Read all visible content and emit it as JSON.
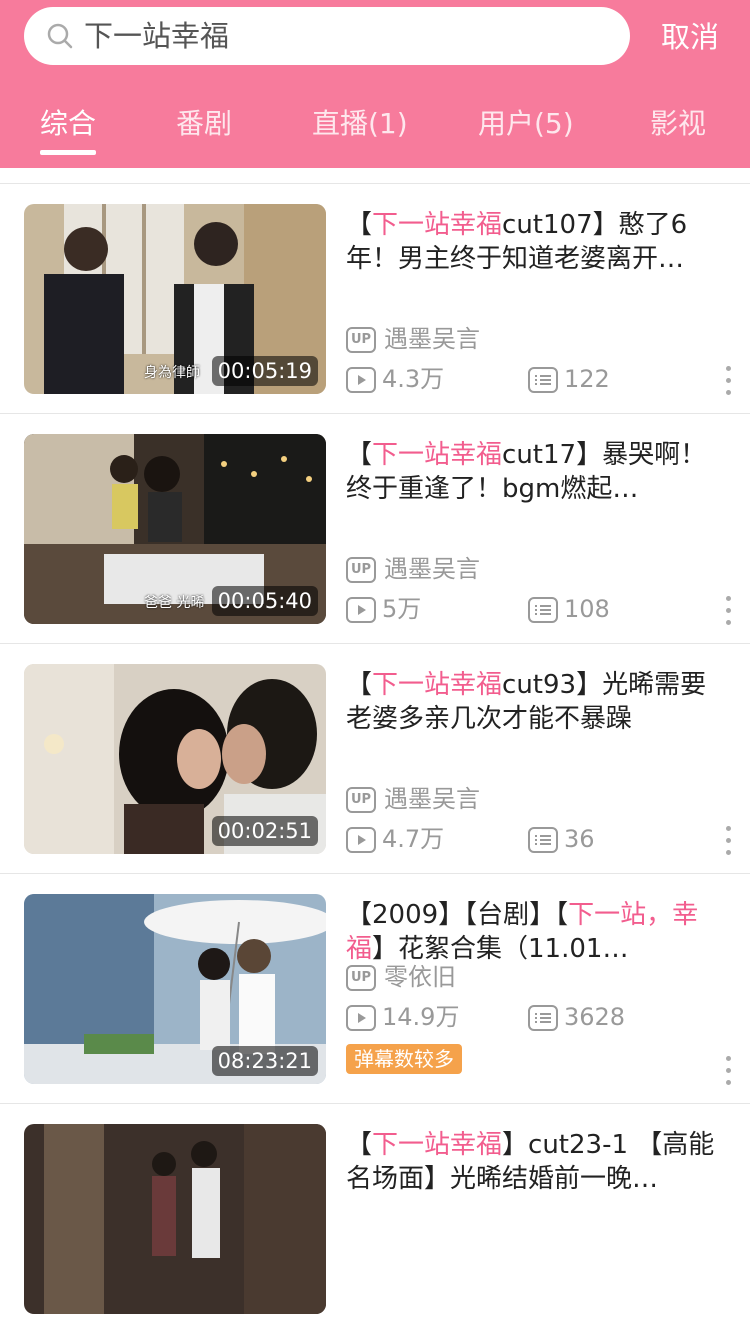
{
  "search": {
    "query": "下一站幸福",
    "cancel_label": "取消"
  },
  "tabs": [
    "综合",
    "番剧",
    "直播(1)",
    "用户(5)",
    "影视"
  ],
  "videos": [
    {
      "title_hl": "下一站幸福",
      "title_pre": "【",
      "title_post": "cut107】憨了6年！男主终于知道老婆离开…",
      "up": "遇墨吴言",
      "plays": "4.3万",
      "danmaku": "122",
      "duration": "00:05:19",
      "caption": "身為律師"
    },
    {
      "title_pre": "【",
      "title_hl": "下一站幸福",
      "title_post": "cut17】暴哭啊！终于重逢了！bgm燃起…",
      "up": "遇墨吴言",
      "plays": "5万",
      "danmaku": "108",
      "duration": "00:05:40",
      "caption": "爸爸 光晞"
    },
    {
      "title_pre": "【",
      "title_hl": "下一站幸福",
      "title_post": "cut93】光晞需要老婆多亲几次才能不暴躁",
      "up": "遇墨吴言",
      "plays": "4.7万",
      "danmaku": "36",
      "duration": "00:02:51"
    },
    {
      "title_pre": "【2009】【台剧】【",
      "title_hl": "下一站，幸福",
      "title_post": "】花絮合集（11.01…",
      "up": "零依旧",
      "plays": "14.9万",
      "danmaku": "3628",
      "duration": "08:23:21",
      "tag": "弹幕数较多"
    },
    {
      "title_pre": "【",
      "title_hl": "下一站幸福",
      "title_post": "】cut23-1 【高能名场面】光晞结婚前一晚…"
    }
  ],
  "colors": {
    "header": "#f77b9c",
    "highlight": "#f25d8e",
    "tag": "#f5a24b"
  }
}
